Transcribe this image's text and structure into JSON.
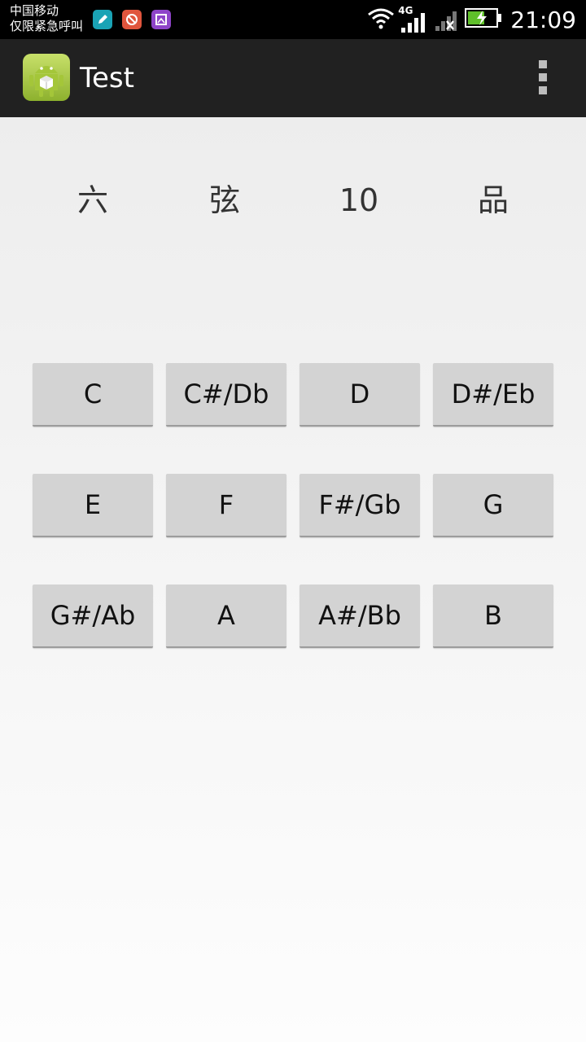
{
  "status_bar": {
    "carrier_line1": "中国移动",
    "carrier_line2": "仅限紧急呼叫",
    "network_type": "4G",
    "time": "21:09",
    "notification_icons": [
      "edit-icon",
      "tool-icon",
      "image-icon"
    ]
  },
  "action_bar": {
    "app_name": "Test",
    "icon": "android-app-icon",
    "overflow_icon": "more-vert-icon"
  },
  "info": {
    "string_label": "六",
    "string_word": "弦",
    "fret_number": "10",
    "fret_word": "品"
  },
  "notes": [
    [
      "C",
      "C#/Db",
      "D",
      "D#/Eb"
    ],
    [
      "E",
      "F",
      "F#/Gb",
      "G"
    ],
    [
      "G#/Ab",
      "A",
      "A#/Bb",
      "B"
    ]
  ],
  "colors": {
    "status_bar_bg": "#000000",
    "action_bar_bg": "#212121",
    "button_bg": "#d3d3d3",
    "text": "#333333"
  }
}
